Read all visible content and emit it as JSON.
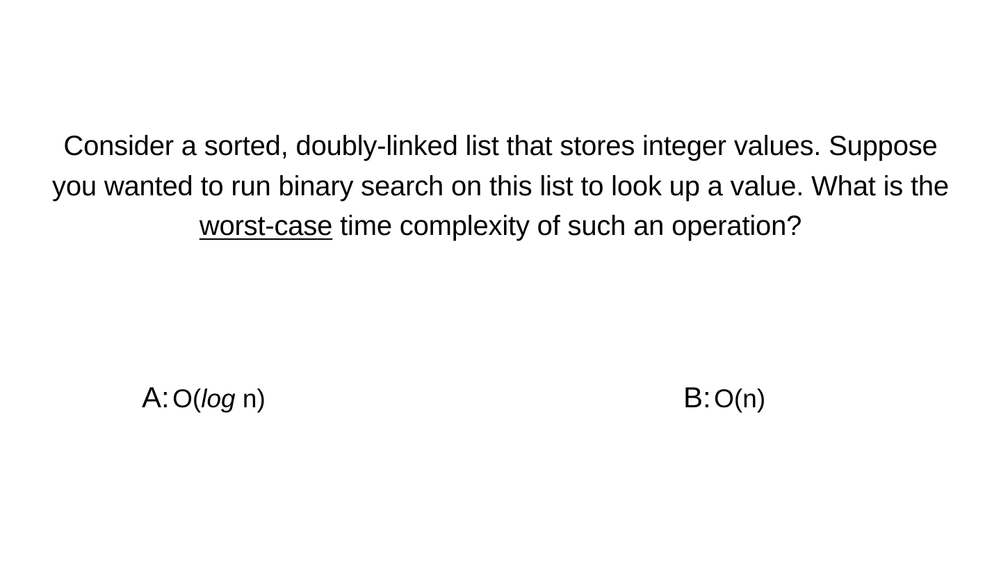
{
  "question": {
    "before_underline": "Consider a sorted, doubly-linked list that stores integer values. Suppose you wanted to run binary search on this list to look up a value. What is the ",
    "underlined": "worst-case",
    "after_underline": " time complexity of such an operation?"
  },
  "options": [
    {
      "letter": "A:",
      "value_prefix": "O(",
      "value_italic": "log",
      "value_suffix": " n)"
    },
    {
      "letter": "B:",
      "value_prefix": "O(n)",
      "value_italic": "",
      "value_suffix": ""
    }
  ]
}
